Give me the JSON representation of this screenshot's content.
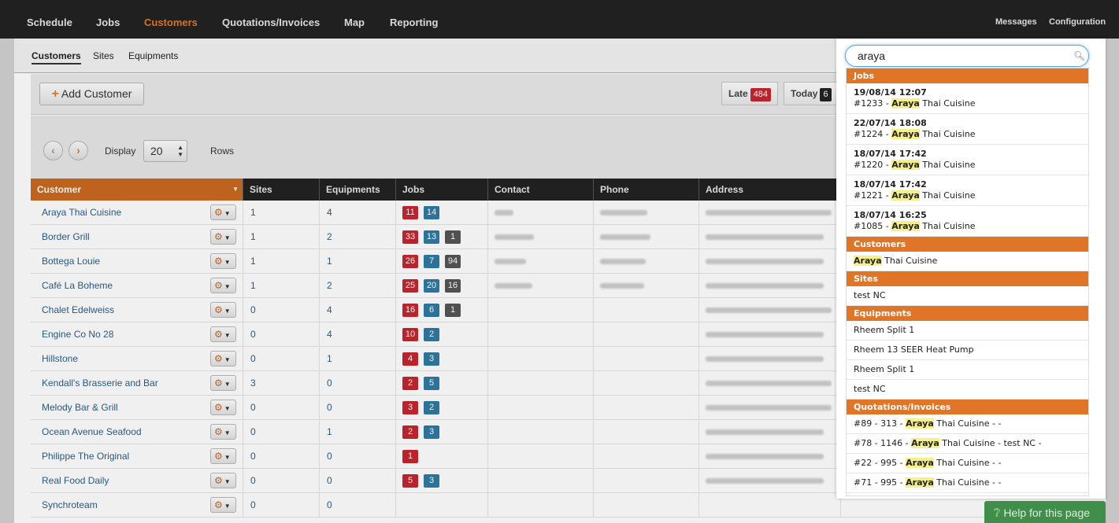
{
  "topnav": {
    "items": [
      "Schedule",
      "Jobs",
      "Customers",
      "Quotations/Invoices",
      "Map",
      "Reporting"
    ],
    "active": "Customers",
    "right": [
      "Messages",
      "Configuration"
    ]
  },
  "subnav": {
    "items": [
      "Customers",
      "Sites",
      "Equipments"
    ]
  },
  "toolbar": {
    "add_label": "Add Customer",
    "late_label": "Late",
    "late_count": "484",
    "today_label": "Today",
    "today_count": "6"
  },
  "rows_control": {
    "display_label": "Display",
    "value": "20",
    "rows_label": "Rows"
  },
  "table": {
    "headers": [
      "Customer",
      "Sites",
      "Equipments",
      "Jobs",
      "Contact",
      "Phone",
      "Address"
    ],
    "rows": [
      {
        "name": "Araya Thai Cuisine",
        "sites": "1",
        "equipments": "4",
        "jobs": [
          [
            "11",
            "red"
          ],
          [
            "14",
            "blue"
          ]
        ]
      },
      {
        "name": "Border Grill",
        "sites": "1",
        "equipments": "2",
        "jobs": [
          [
            "33",
            "red"
          ],
          [
            "13",
            "blue"
          ],
          [
            "1",
            "gray"
          ]
        ]
      },
      {
        "name": "Bottega Louie",
        "sites": "1",
        "equipments": "1",
        "jobs": [
          [
            "26",
            "red"
          ],
          [
            "7",
            "blue"
          ],
          [
            "94",
            "gray"
          ]
        ]
      },
      {
        "name": "Café La Boheme",
        "sites": "1",
        "equipments": "2",
        "jobs": [
          [
            "25",
            "red"
          ],
          [
            "20",
            "blue"
          ],
          [
            "16",
            "gray"
          ]
        ]
      },
      {
        "name": "Chalet Edelweiss",
        "sites": "0",
        "equipments": "4",
        "jobs": [
          [
            "16",
            "red"
          ],
          [
            "6",
            "blue"
          ],
          [
            "1",
            "gray"
          ]
        ]
      },
      {
        "name": "Engine Co No 28",
        "sites": "0",
        "equipments": "4",
        "jobs": [
          [
            "10",
            "red"
          ],
          [
            "2",
            "blue"
          ]
        ]
      },
      {
        "name": "Hillstone",
        "sites": "0",
        "equipments": "1",
        "jobs": [
          [
            "4",
            "red"
          ],
          [
            "3",
            "blue"
          ]
        ]
      },
      {
        "name": "Kendall's Brasserie and Bar",
        "sites": "3",
        "equipments": "0",
        "jobs": [
          [
            "2",
            "red"
          ],
          [
            "5",
            "blue"
          ]
        ]
      },
      {
        "name": "Melody Bar & Grill",
        "sites": "0",
        "equipments": "0",
        "jobs": [
          [
            "3",
            "red"
          ],
          [
            "2",
            "blue"
          ]
        ]
      },
      {
        "name": "Ocean Avenue Seafood",
        "sites": "0",
        "equipments": "1",
        "jobs": [
          [
            "2",
            "red"
          ],
          [
            "3",
            "blue"
          ]
        ]
      },
      {
        "name": "Philippe The Original",
        "sites": "0",
        "equipments": "0",
        "jobs": [
          [
            "1",
            "red"
          ]
        ]
      },
      {
        "name": "Real Food Daily",
        "sites": "0",
        "equipments": "0",
        "jobs": [
          [
            "5",
            "red"
          ],
          [
            "3",
            "blue"
          ]
        ]
      },
      {
        "name": "Synchroteam",
        "sites": "0",
        "equipments": "0",
        "jobs": []
      }
    ]
  },
  "search": {
    "value": "araya",
    "highlight": "Araya",
    "sections": [
      {
        "title": "Jobs",
        "items": [
          {
            "ts": "19/08/14 12:07",
            "pre": "#1233 - ",
            "post": " Thai Cuisine"
          },
          {
            "ts": "22/07/14 18:08",
            "pre": "#1224 - ",
            "post": " Thai Cuisine"
          },
          {
            "ts": "18/07/14 17:42",
            "pre": "#1220 - ",
            "post": " Thai Cuisine"
          },
          {
            "ts": "18/07/14 17:42",
            "pre": "#1221 - ",
            "post": " Thai Cuisine"
          },
          {
            "ts": "18/07/14 16:25",
            "pre": "#1085 - ",
            "post": " Thai Cuisine"
          }
        ]
      },
      {
        "title": "Customers",
        "items": [
          {
            "pre": "",
            "post": " Thai Cuisine"
          }
        ]
      },
      {
        "title": "Sites",
        "items": [
          {
            "text": "test NC"
          }
        ]
      },
      {
        "title": "Equipments",
        "items": [
          {
            "text": "Rheem Split 1"
          },
          {
            "text": "Rheem 13 SEER Heat Pump"
          },
          {
            "text": "Rheem Split 1"
          },
          {
            "text": "test NC"
          }
        ]
      },
      {
        "title": "Quotations/Invoices",
        "items": [
          {
            "pre": "#89 - 313 - ",
            "post": " Thai Cuisine - -"
          },
          {
            "pre": "#78 - 1146 - ",
            "post": " Thai Cuisine - test NC -"
          },
          {
            "pre": "#22 - 995 - ",
            "post": " Thai Cuisine - -"
          },
          {
            "pre": "#71 - 995 - ",
            "post": " Thai Cuisine - -"
          }
        ]
      }
    ]
  },
  "help_label": "Help for this page",
  "colors": {
    "accent": "#e07427",
    "late": "#c6262e",
    "jobs_blue": "#2f7aa3"
  }
}
